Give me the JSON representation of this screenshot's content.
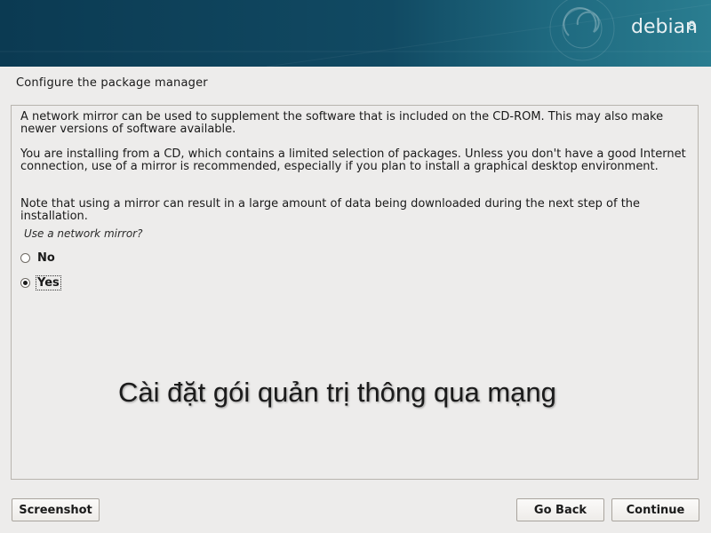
{
  "banner": {
    "logo_text": "debian",
    "version": "8"
  },
  "page": {
    "title": "Configure the package manager"
  },
  "content": {
    "paragraph1": "A network mirror can be used to supplement the software that is included on the CD-ROM. This may also make newer versions of software available.",
    "paragraph2": "You are installing from a CD, which contains a limited selection of packages. Unless you don't have a good Internet connection, use of a mirror is recommended, especially if you plan to install a graphical desktop environment.",
    "paragraph3": "Note that using a mirror can result in a large amount of data being downloaded during the next step of the installation.",
    "question": "Use a network mirror?",
    "options": [
      {
        "label": "No",
        "selected": false
      },
      {
        "label": "Yes",
        "selected": true
      }
    ]
  },
  "overlay": {
    "caption": "Cài đặt gói quản trị thông qua mạng"
  },
  "buttons": {
    "screenshot": "Screenshot",
    "go_back": "Go Back",
    "continue": "Continue"
  },
  "colors": {
    "banner": "#0b3a52",
    "background": "#edeceb"
  }
}
